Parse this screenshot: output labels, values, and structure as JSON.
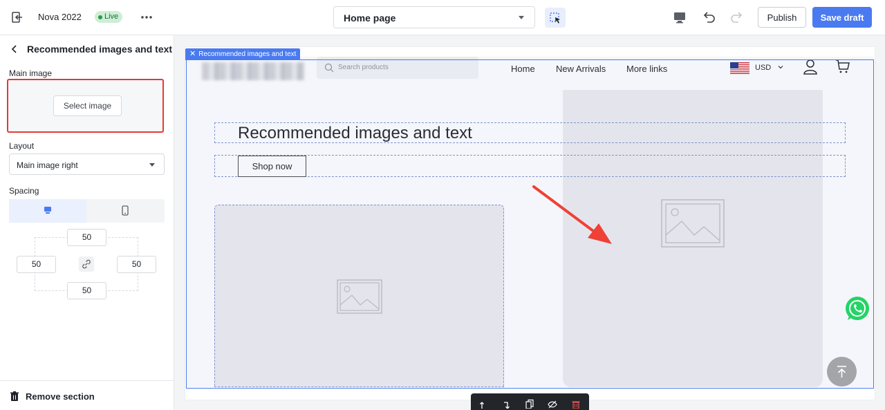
{
  "topbar": {
    "store_name": "Nova 2022",
    "status_badge": "Live",
    "page_selector": "Home page",
    "publish_label": "Publish",
    "save_label": "Save draft"
  },
  "sidebar": {
    "title": "Recommended images and text",
    "main_image_label": "Main image",
    "select_image_label": "Select image",
    "layout_label": "Layout",
    "layout_value": "Main image right",
    "spacing_label": "Spacing",
    "spacing": {
      "top": "50",
      "left": "50",
      "right": "50",
      "bottom": "50"
    },
    "remove_label": "Remove section"
  },
  "canvas": {
    "section_tag": "Recommended images and text",
    "store": {
      "search_placeholder": "Search products",
      "nav": [
        "Home",
        "New Arrivals",
        "More links"
      ],
      "currency": "USD"
    },
    "heading": "Recommended images and text",
    "button_label": "Shop now"
  },
  "colors": {
    "accent": "#4a7af0",
    "highlight_red": "#e53935",
    "live_badge_bg": "#cdeed5",
    "whatsapp": "#25d366"
  },
  "icons": [
    "exit-icon",
    "more-icon",
    "inspect-icon",
    "desktop-icon",
    "undo-icon",
    "redo-icon",
    "back-icon",
    "desktop-tab-icon",
    "mobile-tab-icon",
    "link-icon",
    "trash-icon",
    "search-icon",
    "us-flag-icon",
    "chevron-down-icon",
    "account-icon",
    "cart-icon",
    "image-placeholder-icon",
    "whatsapp-icon",
    "arrow-up-icon",
    "move-up-icon",
    "move-down-icon",
    "duplicate-icon",
    "hide-icon",
    "delete-icon",
    "red-arrow-annotation"
  ]
}
